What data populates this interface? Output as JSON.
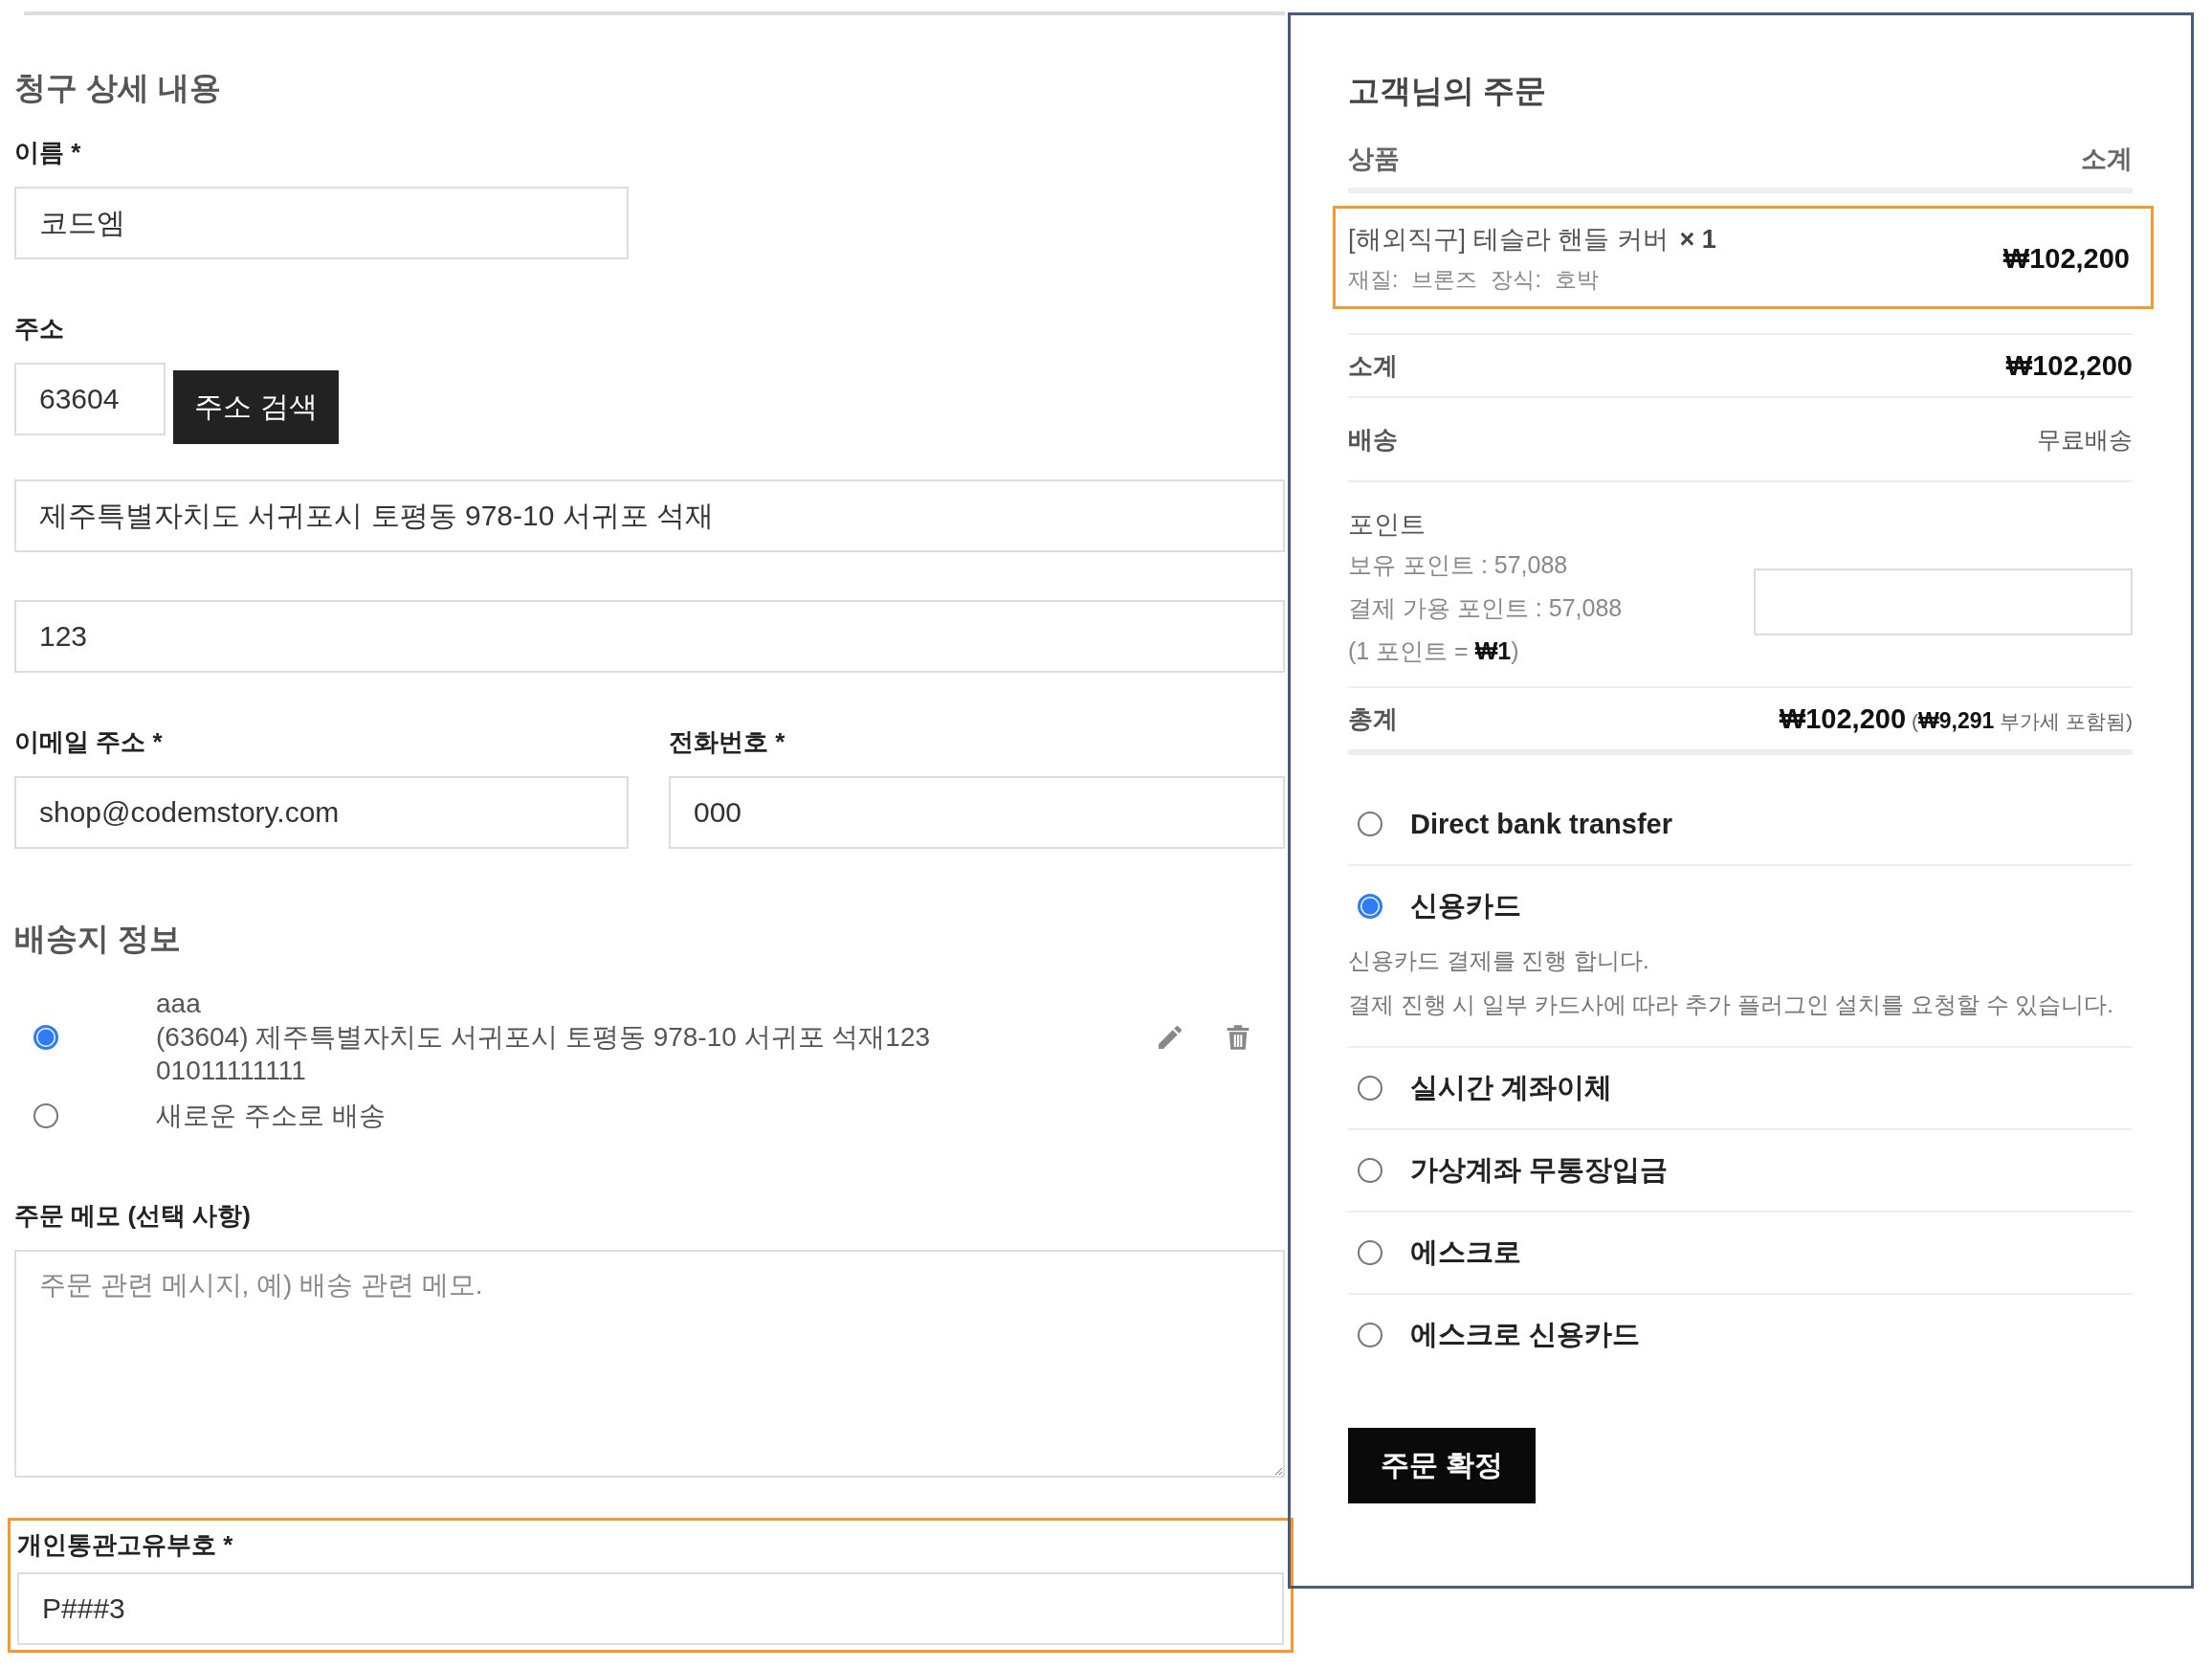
{
  "billing": {
    "title": "청구 상세 내용",
    "name": {
      "label": "이름 *",
      "value": "코드엠"
    },
    "address": {
      "label": "주소",
      "postcode": "63604",
      "search_button": "주소 검색",
      "line1": "제주특별자치도 서귀포시 토평동 978-10 서귀포 석재",
      "line2": "123"
    },
    "email": {
      "label": "이메일 주소 *",
      "value": "shop@codemstory.com"
    },
    "phone": {
      "label": "전화번호 *",
      "value": "000"
    }
  },
  "shipping": {
    "title": "배송지 정보",
    "options": [
      {
        "lines": [
          "aaa",
          "(63604) 제주특별자치도 서귀포시 토평동 978-10 서귀포 석재123",
          "01011111111"
        ],
        "selected": true,
        "editable": true
      },
      {
        "lines": [
          "새로운 주소로 배송"
        ],
        "selected": false,
        "editable": false
      }
    ]
  },
  "order_notes": {
    "label": "주문 메모 (선택 사항)",
    "placeholder": "주문 관련 메시지, 예) 배송 관련 메모."
  },
  "customs": {
    "label": "개인통관고유부호 *",
    "value": "P###3",
    "highlighted": true
  },
  "order": {
    "title": "고객님의 주문",
    "columns": [
      "상품",
      "소계"
    ],
    "items": [
      {
        "name": "[해외직구] 테슬라 핸들 커버",
        "quantity": "× 1",
        "options": [
          {
            "label": "재질:",
            "value": "브론즈"
          },
          {
            "label": "장식:",
            "value": "호박"
          }
        ],
        "total": "₩102,200",
        "highlighted": true
      }
    ],
    "subtotal": {
      "label": "소계",
      "value": "₩102,200"
    },
    "shipping": {
      "label": "배송",
      "value": "무료배송"
    },
    "points": {
      "label": "포인트",
      "lines": [
        "보유 포인트 : 57,088",
        "결제 가용 포인트 : 57,088",
        "(1 포인트 = **₩1**)"
      ]
    },
    "total": {
      "label": "총계",
      "value": "₩102,200",
      "tax_note": "(**₩9,291** 부가세 포함됨)"
    }
  },
  "payment_methods": [
    {
      "label": "Direct bank transfer",
      "selected": false
    },
    {
      "label": "신용카드",
      "selected": true,
      "description": [
        "신용카드 결제를 진행 합니다.",
        "결제 진행 시 일부 카드사에 따라 추가 플러그인 설치를 요청할 수 있습니다."
      ]
    },
    {
      "label": "실시간 계좌이체",
      "selected": false
    },
    {
      "label": "가상계좌 무통장입금",
      "selected": false
    },
    {
      "label": "에스크로",
      "selected": false
    },
    {
      "label": "에스크로 신용카드",
      "selected": false
    }
  ],
  "place_order_button": "주문 확정"
}
